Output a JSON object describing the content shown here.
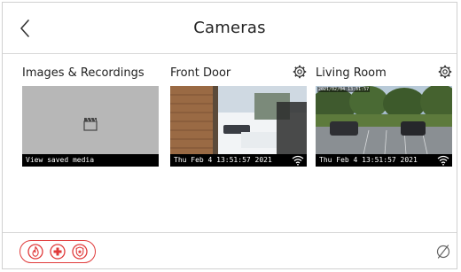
{
  "header": {
    "title": "Cameras"
  },
  "tiles": [
    {
      "label": "Images & Recordings",
      "overlay": "View saved media"
    },
    {
      "label": "Front Door",
      "overlay": "Thu Feb 4 13:51:57 2021"
    },
    {
      "label": "Living Room",
      "overlay": "Thu Feb 4 13:51:57 2021",
      "stamp": "2021/02/04 13:51:57"
    }
  ],
  "colors": {
    "accent_red": "#e03a3a",
    "divider": "#d8d8d8"
  },
  "icons": {
    "back": "chevron-left-icon",
    "settings": "gear-icon",
    "emergency": [
      "fire-icon",
      "medical-cross-icon",
      "police-badge-icon"
    ],
    "status": "no-sync-icon"
  }
}
